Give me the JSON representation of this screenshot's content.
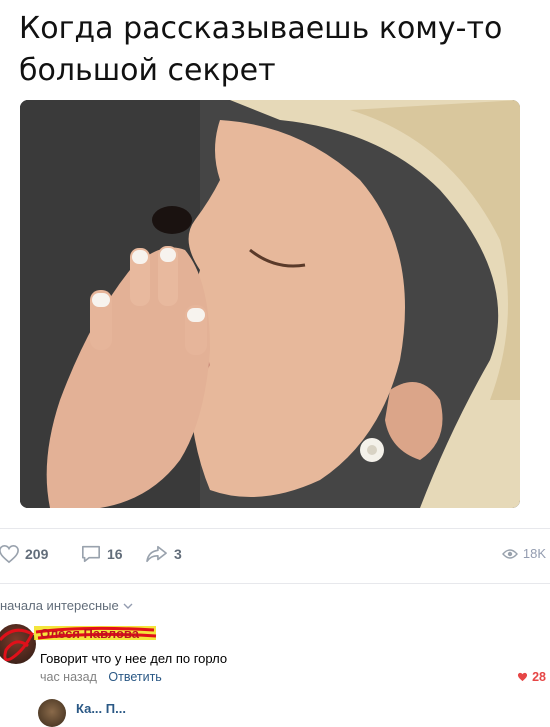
{
  "post": {
    "caption": "Когда рассказываешь кому-то большой секрет"
  },
  "actions": {
    "likes": "209",
    "comments": "16",
    "shares": "3",
    "views": "18K"
  },
  "comments_section": {
    "sort_label": "начала интересные"
  },
  "comments": [
    {
      "author": "Олеся Павлова",
      "text": "Говорит что у нее дел по горло",
      "time": "час назад",
      "reply_label": "Ответить",
      "likes": "28"
    }
  ],
  "next_comment": {
    "author": "Ка... П..."
  },
  "colors": {
    "link": "#2a5885",
    "icon": "#626d7a",
    "like": "#e64646",
    "scribble": "#e0101a",
    "highlight": "#f2e11a"
  }
}
